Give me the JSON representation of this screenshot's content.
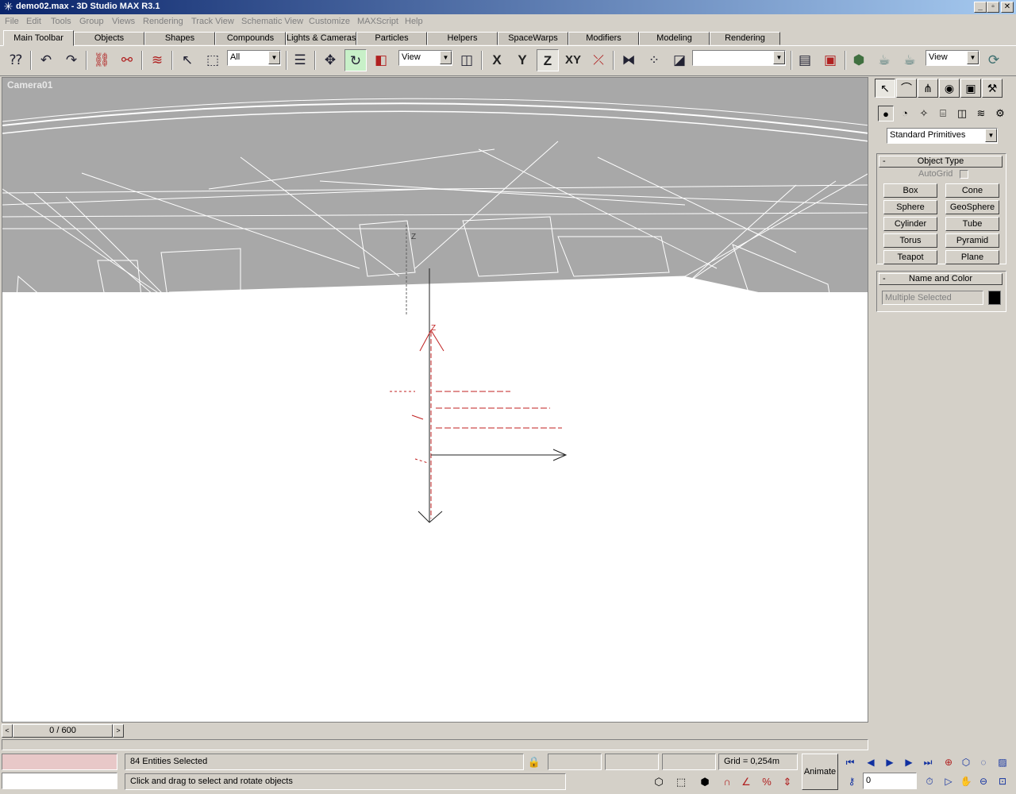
{
  "window": {
    "title": "demo02.max - 3D Studio MAX R3.1",
    "buttons": [
      "_",
      "▫",
      "✕"
    ]
  },
  "menu": [
    "File",
    "Edit",
    "Tools",
    "Group",
    "Views",
    "Rendering",
    "Track View",
    "Schematic View",
    "Customize",
    "MAXScript",
    "Help"
  ],
  "tabs": [
    "Main Toolbar",
    "Objects",
    "Shapes",
    "Compounds",
    "Lights & Cameras",
    "Particles",
    "Helpers",
    "SpaceWarps",
    "Modifiers",
    "Modeling",
    "Rendering"
  ],
  "active_tab": "Main Toolbar",
  "toolbar": {
    "selection_filter": "All",
    "coord_system": "View",
    "axes": [
      "X",
      "Y",
      "Z",
      "XY"
    ],
    "active_axis": "Z",
    "named_selection": "",
    "render_view": "View",
    "active_tool": "select-and-rotate"
  },
  "viewport": {
    "label": "Camera01",
    "gizmo_axis_label": "Z"
  },
  "time_slider": {
    "position": "0 / 600",
    "prev": "<",
    "next": ">"
  },
  "command_panel": {
    "active_tab": "create",
    "category": "Standard Primitives",
    "object_type": {
      "title": "Object Type",
      "collapse": "-",
      "autogrid_label": "AutoGrid",
      "buttons": [
        "Box",
        "Cone",
        "Sphere",
        "GeoSphere",
        "Cylinder",
        "Tube",
        "Torus",
        "Pyramid",
        "Teapot",
        "Plane"
      ]
    },
    "name_and_color": {
      "title": "Name and Color",
      "collapse": "-",
      "name_value": "Multiple Selected",
      "color": "#000000"
    }
  },
  "status": {
    "selection_info": "84 Entities Selected",
    "prompt": "Click and drag to select and rotate objects",
    "grid": "Grid = 0,254m",
    "animate_label": "Animate",
    "frame_value": "0",
    "maxscript_listener_color": "#e8c8c8"
  },
  "colors": {
    "title_gradient_start": "#0a246a",
    "title_gradient_end": "#a6caf0",
    "ui_face": "#d4d0c8",
    "viewport_bg": "#ffffff",
    "gizmo_red": "#c02020"
  }
}
